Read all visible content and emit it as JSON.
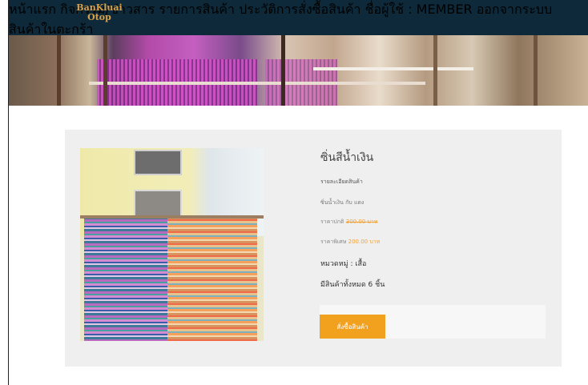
{
  "brand": {
    "line1": "BanKluai",
    "line2": "Otop"
  },
  "nav": {
    "home": "หน้าแรก",
    "activities": "กิจกรรม/ข่าวสาร",
    "products": "รายการสินค้า",
    "order_history": "ประวัติการสั่งซื้อสินค้า",
    "user": "ชื่อผู้ใช้ : MEMBER",
    "logout": "ออกจากระบบ",
    "cart": "สินค้าในตะกร้า"
  },
  "product": {
    "name": "ซิ่นสีน้ำเงิน",
    "detail_heading": "รายละเอียดสินค้า",
    "description": "ซิ่นน้ำเงิน กับ แดง",
    "normal_price_label": "ราคาปกติ",
    "normal_price": "300.00 บาท",
    "special_price_label": "ราคาพิเศษ",
    "special_price": "200.00 บาท",
    "category": "หมวดหมู่ : เสื้อ",
    "stock": "มีสินค้าทั้งหมด 6 ชิ้น",
    "buy_label": "สั่งซื้อสินค้า"
  },
  "colors": {
    "navbar": "#0e2a3a",
    "accent": "#f2a11f",
    "nav_text": "#f0a23a"
  }
}
